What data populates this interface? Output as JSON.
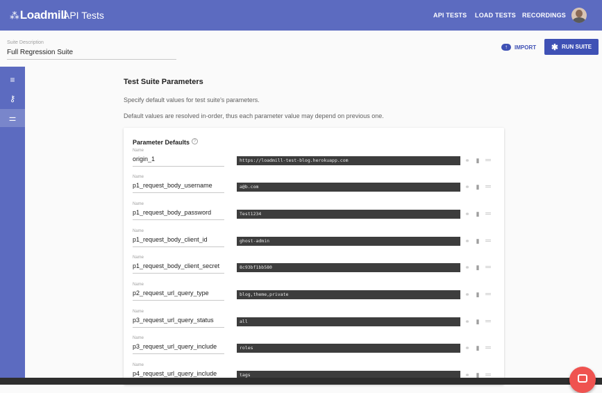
{
  "header": {
    "logo_mark": "⁂",
    "logo_text": "Loadmill",
    "app_title": "API Tests",
    "nav": [
      "API TESTS",
      "LOAD TESTS",
      "RECORDINGS"
    ]
  },
  "suite": {
    "description_label": "Suite Description",
    "description_value": "Full Regression Suite"
  },
  "actions": {
    "import_label": "IMPORT",
    "run_label": "RUN SUITE"
  },
  "sidebar": {
    "items": [
      {
        "icon": "list-icon",
        "glyph": "≡"
      },
      {
        "icon": "key-icon",
        "glyph": "⚷"
      },
      {
        "icon": "sliders-icon",
        "glyph": "⚌"
      }
    ]
  },
  "main": {
    "title": "Test Suite Parameters",
    "description_1": "Specify default values for test suite's parameters.",
    "description_2": "Default values are resolved in-order, thus each parameter value may depend on previous one.",
    "card_title": "Parameter Defaults",
    "help_glyph": "?",
    "field_label": "Name",
    "params": [
      {
        "name": "origin_1",
        "value": "https://loadmill-test-blog.herokuapp.com"
      },
      {
        "name": "p1_request_body_username",
        "value": "a@b.com"
      },
      {
        "name": "p1_request_body_password",
        "value": "Test1234"
      },
      {
        "name": "p1_request_body_client_id",
        "value": "ghost-admin"
      },
      {
        "name": "p1_request_body_client_secret",
        "value": "8c93bf1bb580"
      },
      {
        "name": "p2_request_url_query_type",
        "value": "blog,theme,private"
      },
      {
        "name": "p3_request_url_query_status",
        "value": "all"
      },
      {
        "name": "p3_request_url_query_include",
        "value": "roles"
      },
      {
        "name": "p4_request_url_query_include",
        "value": "tags"
      }
    ]
  },
  "colors": {
    "primary": "#5c6bc0",
    "accent": "#3f51b5",
    "fab": "#ef5350"
  }
}
